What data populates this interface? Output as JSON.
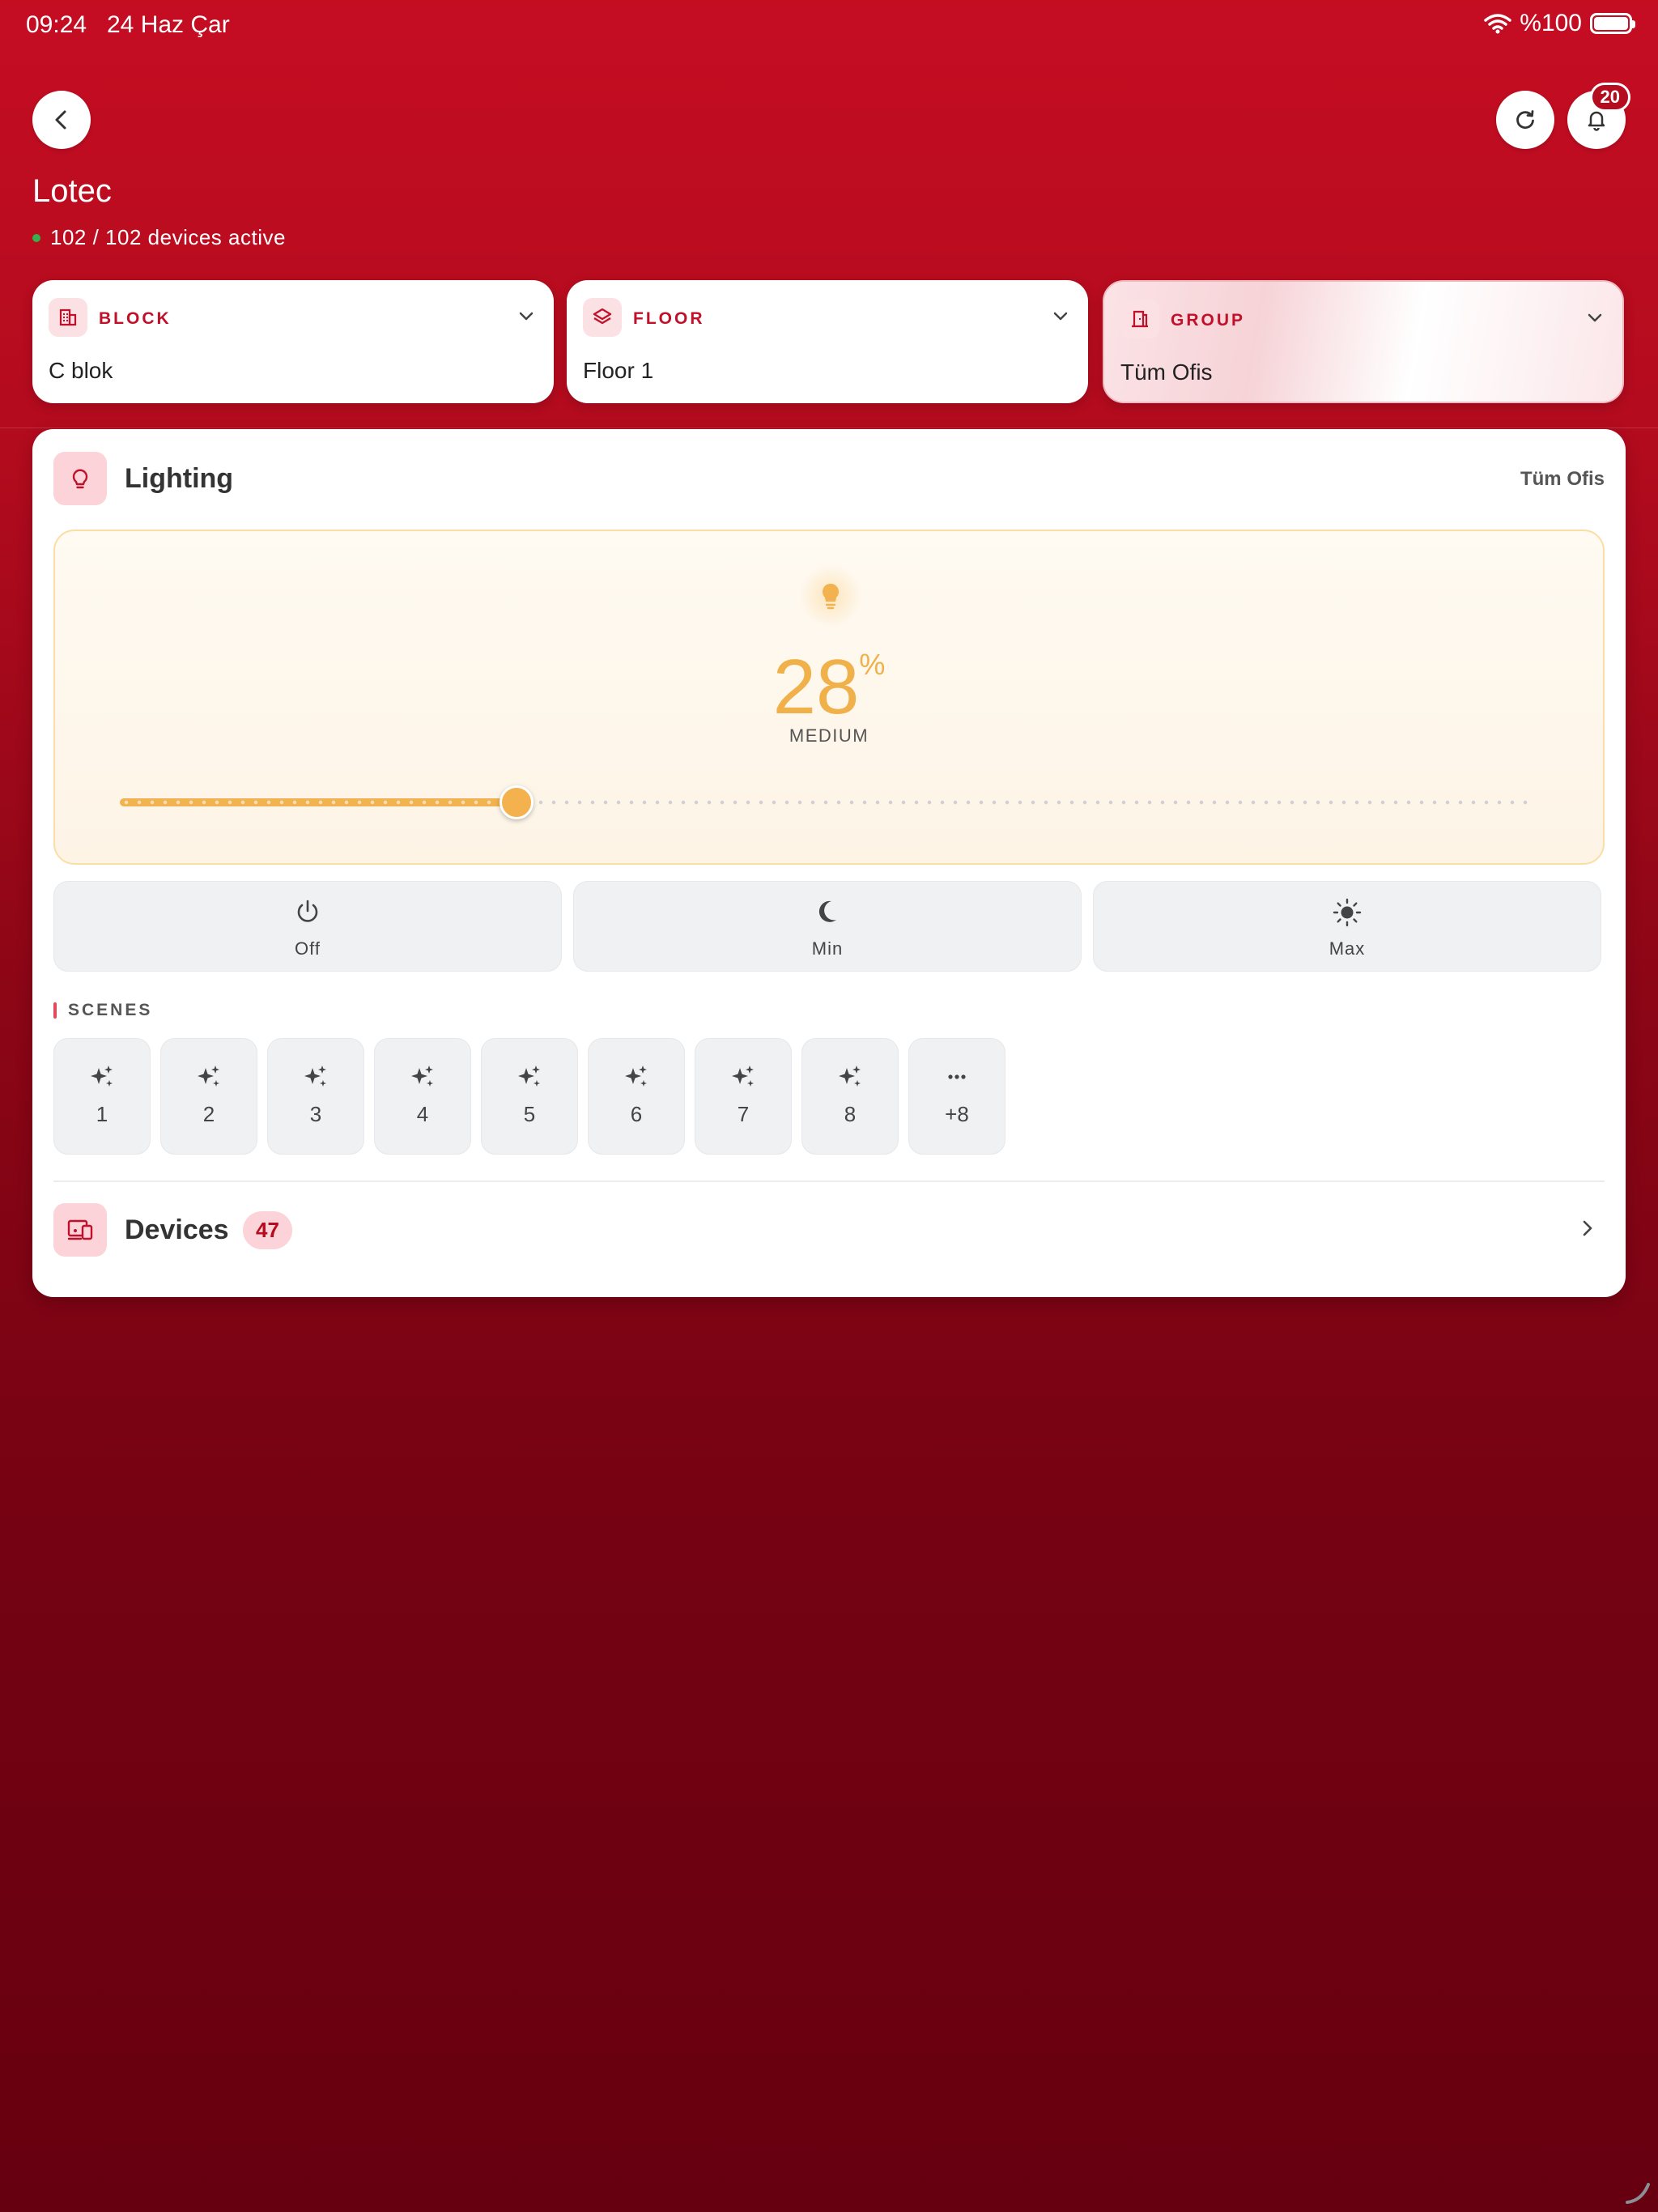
{
  "status_bar": {
    "time": "09:24",
    "date": "24 Haz Çar",
    "battery": "%100"
  },
  "header": {
    "title": "Lotec",
    "active_devices": "102 / 102 devices active",
    "notification_count": "20"
  },
  "selectors": {
    "block": {
      "label": "BLOCK",
      "value": "C blok"
    },
    "floor": {
      "label": "FLOOR",
      "value": "Floor 1"
    },
    "group": {
      "label": "GROUP",
      "value": "Tüm Ofis"
    }
  },
  "lighting": {
    "title": "Lighting",
    "group_name": "Tüm Ofis",
    "level": "28",
    "level_fraction": 0.28,
    "percent_symbol": "%",
    "level_name": "MEDIUM",
    "accent_color": "#f2b24f"
  },
  "modes": [
    {
      "label": "Off",
      "icon": "power-icon"
    },
    {
      "label": "Min",
      "icon": "moon-icon"
    },
    {
      "label": "Max",
      "icon": "sun-icon"
    }
  ],
  "scenes": {
    "title": "SCENES",
    "items": [
      "1",
      "2",
      "3",
      "4",
      "5",
      "6",
      "7",
      "8"
    ],
    "more": "+8"
  },
  "devices": {
    "title": "Devices",
    "count": "47"
  },
  "colors": {
    "brand_red": "#c50d22",
    "badge_bg": "#fbd3d8"
  }
}
